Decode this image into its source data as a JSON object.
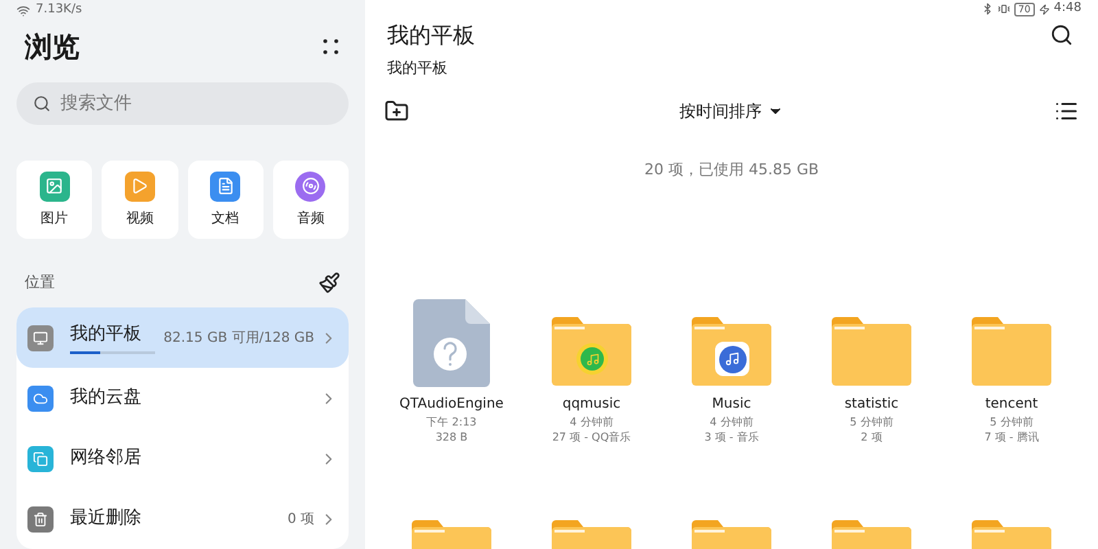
{
  "status_bar": {
    "speed": "7.13K/s",
    "battery": "70",
    "time": "4:48"
  },
  "sidebar": {
    "title": "浏览",
    "search": {
      "placeholder": "搜索文件"
    },
    "categories": [
      {
        "kind": "image",
        "label": "图片"
      },
      {
        "kind": "video",
        "label": "视频"
      },
      {
        "kind": "document",
        "label": "文档"
      },
      {
        "kind": "audio",
        "label": "音频"
      }
    ],
    "section_title": "位置",
    "locations": [
      {
        "kind": "tablet",
        "label": "我的平板",
        "detail": "82.15 GB 可用/128 GB",
        "level": 0.36,
        "selected": true
      },
      {
        "kind": "cloud",
        "label": "我的云盘",
        "selected": false
      },
      {
        "kind": "network",
        "label": "网络邻居",
        "selected": false
      },
      {
        "kind": "trash",
        "label": "最近删除",
        "detail": "0 项",
        "selected": false
      }
    ]
  },
  "main": {
    "title": "我的平板",
    "breadcrumb": "我的平板",
    "sort": "按时间排序",
    "summary": "20 项，已使用 45.85 GB",
    "files": [
      {
        "kind": "unknown",
        "name": "QTAudioEngine",
        "time": "下午 2:13",
        "info": "328 B"
      },
      {
        "kind": "qqmusic_folder",
        "name": "qqmusic",
        "time": "4 分钟前",
        "info": "27 项 - QQ音乐"
      },
      {
        "kind": "music_folder",
        "name": "Music",
        "time": "4 分钟前",
        "info": "3 项 - 音乐"
      },
      {
        "kind": "folder",
        "name": "statistic",
        "time": "5 分钟前",
        "info": "2 项"
      },
      {
        "kind": "folder",
        "name": "tencent",
        "time": "5 分钟前",
        "info": "7 项 - 腾讯"
      },
      {
        "kind": "folder"
      },
      {
        "kind": "folder"
      },
      {
        "kind": "folder"
      },
      {
        "kind": "folder"
      },
      {
        "kind": "folder"
      }
    ]
  }
}
